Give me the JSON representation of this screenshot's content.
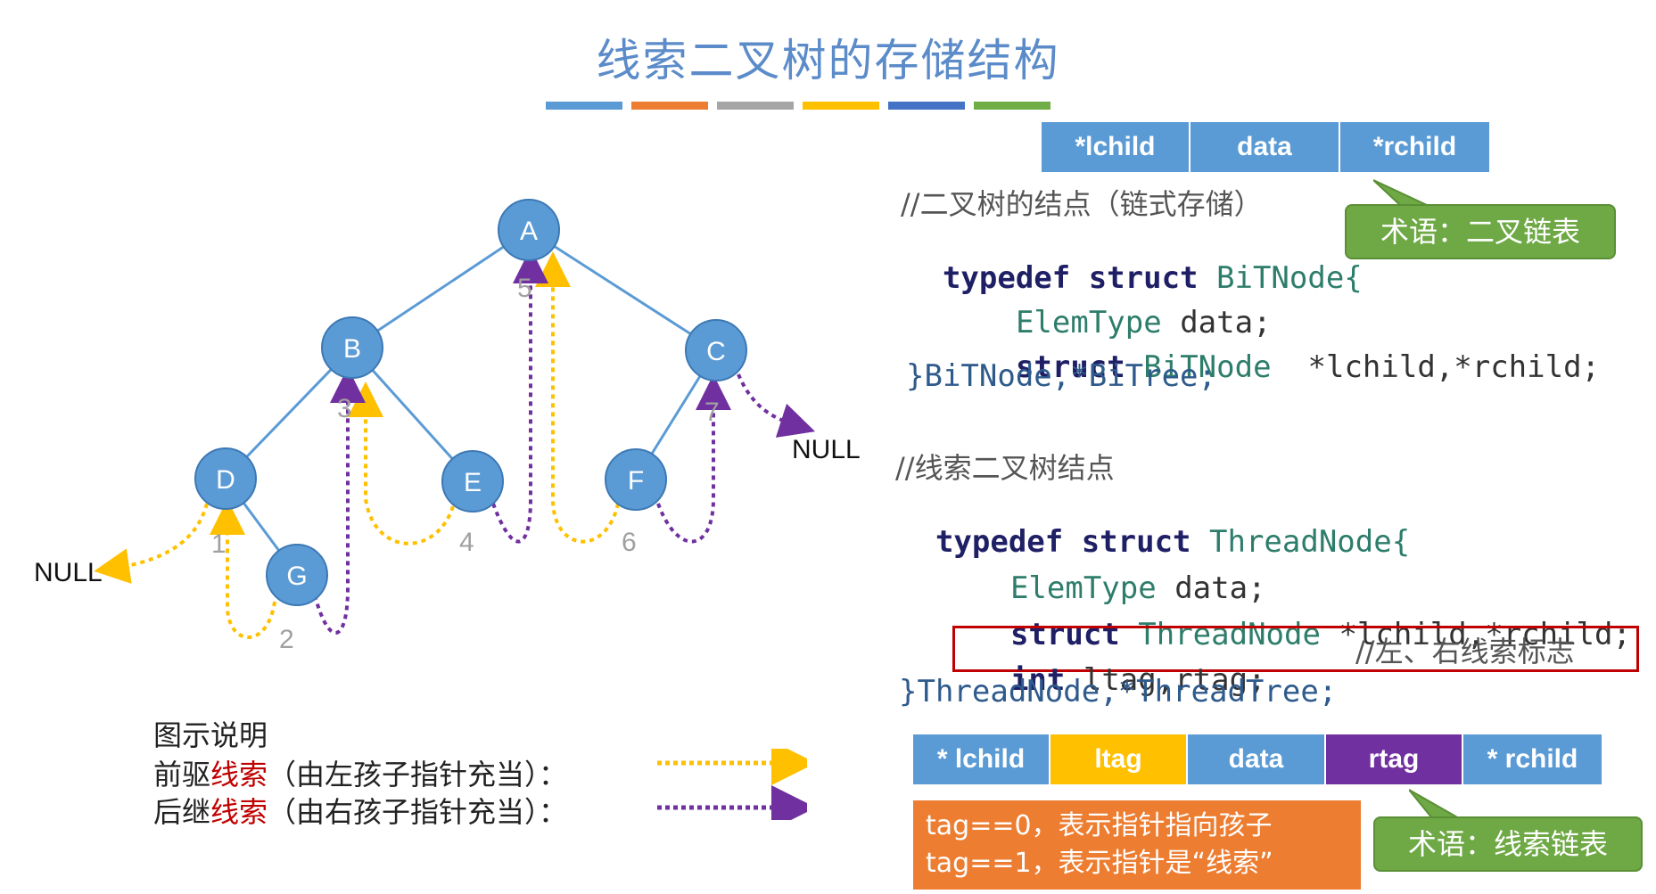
{
  "title": "线索二叉树的存储结构",
  "title_bar_colors": [
    "#5b9bd5",
    "#ed7d31",
    "#a5a5a5",
    "#ffc000",
    "#4472c4",
    "#70ad47"
  ],
  "bitnode_fields": [
    "*lchild",
    "data",
    "*rchild"
  ],
  "callout1": "术语：二叉链表",
  "code1": {
    "comment": "//二叉树的结点（链式存储）",
    "line1_kw": "typedef struct",
    "line1_name": "BiTNode{",
    "line2_type": "ElemType",
    "line2_rest": "data;",
    "line3_kw": "struct",
    "line3_type": "BiTNode",
    "line3_rest": "*lchild,*rchild;",
    "line4": "}BiTNode,*BiTree;"
  },
  "code2": {
    "comment": "//线索二叉树结点",
    "line1_kw": "typedef struct",
    "line1_name": "ThreadNode{",
    "line2_type": "ElemType",
    "line2_rest": "data;",
    "line3_kw": "struct",
    "line3_type": "ThreadNode",
    "line3_rest": "*lchild,*rchild;",
    "line4_kw": "int",
    "line4_rest": "ltag,rtag;",
    "line4_comment": "//左、右线索标志",
    "line5": "}ThreadNode,*ThreadTree;"
  },
  "threadnode_fields": [
    "* lchild",
    "ltag",
    "data",
    "rtag",
    "* rchild"
  ],
  "threadnode_colors": [
    "#5b9bd5",
    "#ffc000",
    "#5b9bd5",
    "#7030a0",
    "#5b9bd5"
  ],
  "tag_note": [
    "tag==0，表示指针指向孩子",
    "tag==1，表示指针是“线索”"
  ],
  "callout2": "术语：线索链表",
  "tree": {
    "nodes": [
      "A",
      "B",
      "C",
      "D",
      "E",
      "F",
      "G"
    ],
    "order_numbers": [
      "1",
      "2",
      "3",
      "4",
      "5",
      "6",
      "7"
    ],
    "null_labels": [
      "NULL",
      "NULL"
    ]
  },
  "legend": {
    "heading": "图示说明",
    "pred_prefix": "前驱",
    "pred_red": "线索",
    "pred_suffix": "（由左孩子指针充当）：",
    "succ_prefix": "后继",
    "succ_red": "线索",
    "succ_suffix": "（由右孩子指针充当）：",
    "pred_color": "#ffc000",
    "succ_color": "#7030a0"
  },
  "node_color": "#5b9bd5",
  "edge_color": "#5b9bd5"
}
